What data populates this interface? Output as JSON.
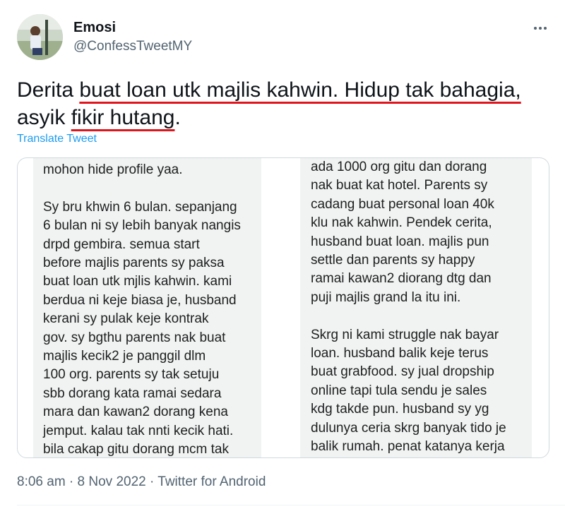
{
  "author": {
    "display_name": "Emosi",
    "handle": "@ConfessTweetMY"
  },
  "tweet": {
    "text_parts": [
      "Derita ",
      "buat loan utk majlis kahwin. Hidup tak bahagia,",
      "asyik ",
      "fikir hutang",
      "."
    ],
    "translate_label": "Translate Tweet"
  },
  "image_text": {
    "left": [
      "mohon hide profile yaa.",
      "",
      "Sy bru khwin 6 bulan. sepanjang",
      "6 bulan ni sy lebih banyak nangis",
      "drpd gembira. semua start",
      "before majlis parents sy paksa",
      "buat loan utk mjlis kahwin. kami",
      "berdua ni keje biasa je, husband",
      "kerani sy pulak keje kontrak",
      "gov. sy bgthu parents nak buat",
      "majlis kecik2 je panggil dlm",
      "100 org. parents sy tak setuju",
      "sbb dorang kata ramai sedara",
      "mara dan kawan2 dorang kena",
      "jemput. kalau tak nnti kecik hati.",
      "bila cakap gitu dorang mcm tak"
    ],
    "right": [
      "ada 1000 org gitu dan dorang",
      "nak buat kat hotel. Parents sy",
      "cadang buat personal loan 40k",
      "klu nak kahwin. Pendek cerita,",
      "husband buat loan. majlis pun",
      "settle dan parents sy happy",
      "ramai kawan2 diorang dtg dan",
      "puji majlis grand la itu ini.",
      "",
      "Skrg ni kami struggle nak bayar",
      "loan. husband balik keje terus",
      "buat grabfood. sy jual dropship",
      "online tapi tula sendu je sales",
      "kdg takde pun. husband sy yg",
      "dulunya ceria skrg banyak tido je",
      "balik rumah. penat katanya kerja"
    ]
  },
  "meta": {
    "time": "8:06 am",
    "sep1": " · ",
    "date": "8 Nov 2022",
    "sep2": " · ",
    "source": "Twitter for Android"
  },
  "colors": {
    "link": "#1d9bf0",
    "underline": "#e0141c",
    "secondary": "#536471"
  },
  "icons": {
    "more": "more-options-icon"
  }
}
